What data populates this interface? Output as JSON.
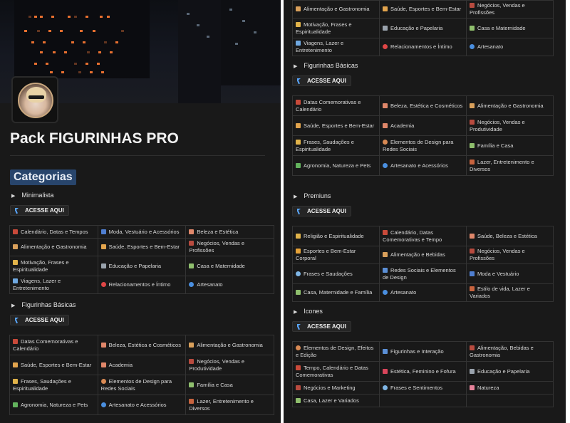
{
  "page": {
    "title": "Pack FIGURINHAS PRO",
    "heading": "Categorias",
    "button_label": "ACESSE AQUI"
  },
  "colors": {
    "background": "#191919",
    "heading_bg": "#28456c",
    "border": "#333333",
    "cursor_icon": "#5aa7ff"
  },
  "left": {
    "minimalista": {
      "label": "Minimalista",
      "rows": [
        [
          {
            "icon": "calendar-icon",
            "text": "Calendário, Datas e Tempos"
          },
          {
            "icon": "shirt-icon",
            "text": "Moda, Vestuário e Acessórios"
          },
          {
            "icon": "beauty-icon",
            "text": "Beleza e Estética"
          }
        ],
        [
          {
            "icon": "food-icon",
            "text": "Alimentação e Gastronomia"
          },
          {
            "icon": "sport-icon",
            "text": "Saúde, Esportes e Bem-Estar"
          },
          {
            "icon": "briefcase-icon",
            "text": "Negócios, Vendas e Profissões"
          }
        ],
        [
          {
            "icon": "pray-icon",
            "text": "Motivação, Frases e Espiritualidade"
          },
          {
            "icon": "book-icon",
            "text": "Educação e Papelaria"
          },
          {
            "icon": "home-icon",
            "text": "Casa e Maternidade"
          }
        ],
        [
          {
            "icon": "plane-icon",
            "text": "Viagens, Lazer e Entretenimento"
          },
          {
            "icon": "heart-icon",
            "text": "Relacionamentos e Íntimo"
          },
          {
            "icon": "palette-icon",
            "text": "Artesanato"
          }
        ]
      ]
    },
    "basicas": {
      "label": "Figurinhas Básicas",
      "rows": [
        [
          {
            "icon": "calendar-icon",
            "text": "Datas Comemorativas e Calendário"
          },
          {
            "icon": "beauty-icon",
            "text": "Beleza, Estética e Cosméticos"
          },
          {
            "icon": "food-icon",
            "text": "Alimentação e Gastronomia"
          }
        ],
        [
          {
            "icon": "sport-icon",
            "text": "Saúde, Esportes e Bem-Estar"
          },
          {
            "icon": "beauty-icon",
            "text": "Academia"
          },
          {
            "icon": "briefcase-icon",
            "text": "Negócios, Vendas e Produtividade"
          }
        ],
        [
          {
            "icon": "pray-icon",
            "text": "Frases, Saudações e Espiritualidade"
          },
          {
            "icon": "design-icon",
            "text": "Elementos de Design para Redes Sociais"
          },
          {
            "icon": "home-icon",
            "text": "Família e Casa"
          }
        ],
        [
          {
            "icon": "plant-icon",
            "text": "Agronomia, Natureza e Pets"
          },
          {
            "icon": "palette-icon",
            "text": "Artesanato e Acessórios"
          },
          {
            "icon": "gift-icon",
            "text": "Lazer, Entretenimento e Diversos"
          }
        ]
      ]
    }
  },
  "right": {
    "top_rows": [
      [
        {
          "icon": "food-icon",
          "text": "Alimentação e Gastronomia"
        },
        {
          "icon": "sport-icon",
          "text": "Saúde, Esportes e Bem-Estar"
        },
        {
          "icon": "briefcase-icon",
          "text": "Negócios, Vendas e Profissões"
        }
      ],
      [
        {
          "icon": "pray-icon",
          "text": "Motivação, Frases e Espiritualidade"
        },
        {
          "icon": "book-icon",
          "text": "Educação e Papelaria"
        },
        {
          "icon": "home-icon",
          "text": "Casa e Maternidade"
        }
      ],
      [
        {
          "icon": "plane-icon",
          "text": "Viagens, Lazer e Entretenimento"
        },
        {
          "icon": "heart-icon",
          "text": "Relacionamentos e Íntimo"
        },
        {
          "icon": "palette-icon",
          "text": "Artesanato"
        }
      ]
    ],
    "basicas": {
      "label": "Figurinhas Básicas",
      "rows": [
        [
          {
            "icon": "calendar-icon",
            "text": "Datas Comemorativas e Calendário"
          },
          {
            "icon": "beauty-icon",
            "text": "Beleza, Estética e Cosméticos"
          },
          {
            "icon": "food-icon",
            "text": "Alimentação e Gastronomia"
          }
        ],
        [
          {
            "icon": "sport-icon",
            "text": "Saúde, Esportes e Bem-Estar"
          },
          {
            "icon": "beauty-icon",
            "text": "Academia"
          },
          {
            "icon": "briefcase-icon",
            "text": "Negócios, Vendas e Produtividade"
          }
        ],
        [
          {
            "icon": "pray-icon",
            "text": "Frases, Saudações e Espiritualidade"
          },
          {
            "icon": "design-icon",
            "text": "Elementos de Design para Redes Sociais"
          },
          {
            "icon": "home-icon",
            "text": "Família e Casa"
          }
        ],
        [
          {
            "icon": "plant-icon",
            "text": "Agronomia, Natureza e Pets"
          },
          {
            "icon": "palette-icon",
            "text": "Artesanato e Acessórios"
          },
          {
            "icon": "gift-icon",
            "text": "Lazer, Entretenimento e Diversos"
          }
        ]
      ]
    },
    "premiuns": {
      "label": "Premiuns",
      "rows": [
        [
          {
            "icon": "pray-icon",
            "text": "Religião e Espiritualidade"
          },
          {
            "icon": "calendar-icon",
            "text": "Calendário, Datas Comemorativas e Tempo"
          },
          {
            "icon": "beauty-icon",
            "text": "Saúde, Beleza e Estética"
          }
        ],
        [
          {
            "icon": "trophy-icon",
            "text": "Esportes e Bem-Estar Corporal"
          },
          {
            "icon": "food-icon",
            "text": "Alimentação e Bebidas"
          },
          {
            "icon": "briefcase-icon",
            "text": "Negócios, Vendas e Profissões"
          }
        ],
        [
          {
            "icon": "chat-icon",
            "text": "Frases e Saudações"
          },
          {
            "icon": "pin-icon",
            "text": "Redes Sociais e Elementos de Design"
          },
          {
            "icon": "shirt-icon",
            "text": "Moda e Vestuário"
          }
        ],
        [
          {
            "icon": "home-icon",
            "text": "Casa, Maternidade e Família"
          },
          {
            "icon": "palette-icon",
            "text": "Artesanato"
          },
          {
            "icon": "gift-icon",
            "text": "Estilo de vida, Lazer e Variados"
          }
        ]
      ]
    },
    "icones": {
      "label": "Icones",
      "rows": [
        [
          {
            "icon": "design-icon",
            "text": "Elementos de Design, Efeitos e Edição"
          },
          {
            "icon": "pin-icon",
            "text": "Figurinhas e Interação"
          },
          {
            "icon": "briefcase-icon",
            "text": "Alimentação, Bebidas e Gastronomia"
          }
        ],
        [
          {
            "icon": "calendar-icon",
            "text": "Tempo, Calendário e Datas Comemorativas"
          },
          {
            "icon": "female-icon",
            "text": "Estética, Feminino e Fofura"
          },
          {
            "icon": "book-icon",
            "text": "Educação e Papelaria"
          }
        ],
        [
          {
            "icon": "briefcase-icon",
            "text": "Negócios e Marketing"
          },
          {
            "icon": "chat-icon",
            "text": "Frases e Sentimentos"
          },
          {
            "icon": "star-icon",
            "text": "Natureza"
          }
        ],
        [
          {
            "icon": "home-icon",
            "text": "Casa, Lazer e Variados"
          },
          {
            "icon": "",
            "text": ""
          },
          {
            "icon": "",
            "text": ""
          }
        ]
      ]
    }
  }
}
